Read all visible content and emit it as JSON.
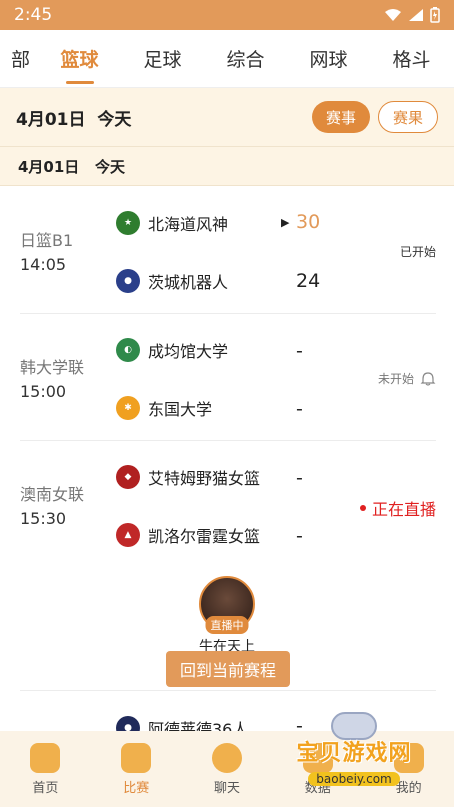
{
  "status_bar": {
    "time": "2:45"
  },
  "sport_tabs": [
    "全部",
    "篮球",
    "足球",
    "综合",
    "网球",
    "格斗"
  ],
  "sport_tabs_visible": [
    "部",
    "篮球",
    "足球",
    "综合",
    "网球",
    "格斗"
  ],
  "active_tab_index": 1,
  "date_bar": {
    "date": "4月01日",
    "day": "今天",
    "btn_schedule": "赛事",
    "btn_result": "赛果"
  },
  "date_sub": {
    "date": "4月01日",
    "day": "今天"
  },
  "matches": [
    {
      "league": "日篮B1",
      "time": "14:05",
      "home": {
        "name": "北海道风神",
        "score": "30"
      },
      "away": {
        "name": "茨城机器人",
        "score": "24"
      },
      "status": "已开始"
    },
    {
      "league": "韩大学联",
      "time": "15:00",
      "home": {
        "name": "成均馆大学",
        "score": "-"
      },
      "away": {
        "name": "东国大学",
        "score": "-"
      },
      "status": "未开始"
    },
    {
      "league": "澳南女联",
      "time": "15:30",
      "home": {
        "name": "艾特姆野猫女篮",
        "score": "-"
      },
      "away": {
        "name": "凯洛尔雷霆女篮",
        "score": "-"
      },
      "status": "正在直播"
    }
  ],
  "anchor": {
    "badge": "直播中",
    "name": "牛在天上"
  },
  "back_button": "回到当前赛程",
  "partial_match": {
    "home": {
      "name": "阿德莱德36人",
      "score": "-"
    }
  },
  "bottom_nav": [
    {
      "label": "首页"
    },
    {
      "label": "比赛"
    },
    {
      "label": "聊天"
    },
    {
      "label": "数据"
    },
    {
      "label": "我的"
    }
  ],
  "watermark": {
    "title": "宝贝游戏网",
    "url": "baobeiy.com"
  },
  "colors": {
    "accent": "#e08a3c",
    "status_bar": "#e29a5a",
    "live": "#e02020",
    "date_bg": "#fdf4e4"
  }
}
